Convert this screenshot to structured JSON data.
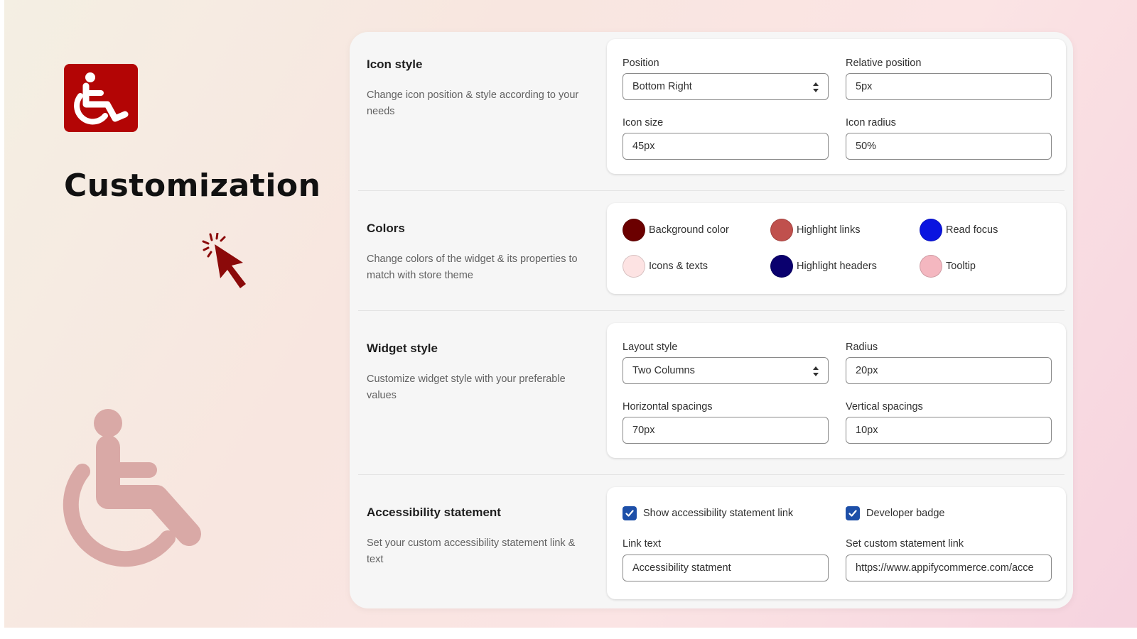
{
  "hero": {
    "title": "Customization",
    "logo_icon": "wheelchair-icon",
    "cursor_icon": "click-cursor-icon",
    "decor_icon": "wheelchair-icon",
    "brand_color": "#b30505"
  },
  "sections": {
    "icon_style": {
      "title": "Icon style",
      "description": "Change icon position & style according to your needs",
      "position_label": "Position",
      "position_value": "Bottom Right",
      "relative_position_label": "Relative position",
      "relative_position_value": "5px",
      "icon_size_label": "Icon size",
      "icon_size_value": "45px",
      "icon_radius_label": "Icon radius",
      "icon_radius_value": "50%"
    },
    "colors": {
      "title": "Colors",
      "description": "Change colors of the widget & its properties to match with store theme",
      "items": [
        {
          "label": "Background color",
          "color": "#6b0000"
        },
        {
          "label": "Highlight links",
          "color": "#c0504d"
        },
        {
          "label": "Read focus",
          "color": "#0a14e0"
        },
        {
          "label": "Icons & texts",
          "color": "#fde3e3"
        },
        {
          "label": "Highlight headers",
          "color": "#0a006e"
        },
        {
          "label": "Tooltip",
          "color": "#f4b7c0"
        }
      ]
    },
    "widget_style": {
      "title": "Widget style",
      "description": "Customize widget style with your preferable values",
      "layout_label": "Layout style",
      "layout_value": "Two Columns",
      "radius_label": "Radius",
      "radius_value": "20px",
      "hspacing_label": "Horizontal spacings",
      "hspacing_value": "70px",
      "vspacing_label": "Vertical spacings",
      "vspacing_value": "10px"
    },
    "statement": {
      "title": "Accessibility statement",
      "description": "Set your custom accessibility statement link & text",
      "show_link_label": "Show accessibility statement link",
      "show_link_checked": true,
      "dev_badge_label": "Developer badge",
      "dev_badge_checked": true,
      "link_text_label": "Link text",
      "link_text_value": "Accessibility statment",
      "custom_link_label": "Set custom statement link",
      "custom_link_value": "https://www.appifycommerce.com/acce"
    }
  },
  "accent_color": "#1d4fa8"
}
